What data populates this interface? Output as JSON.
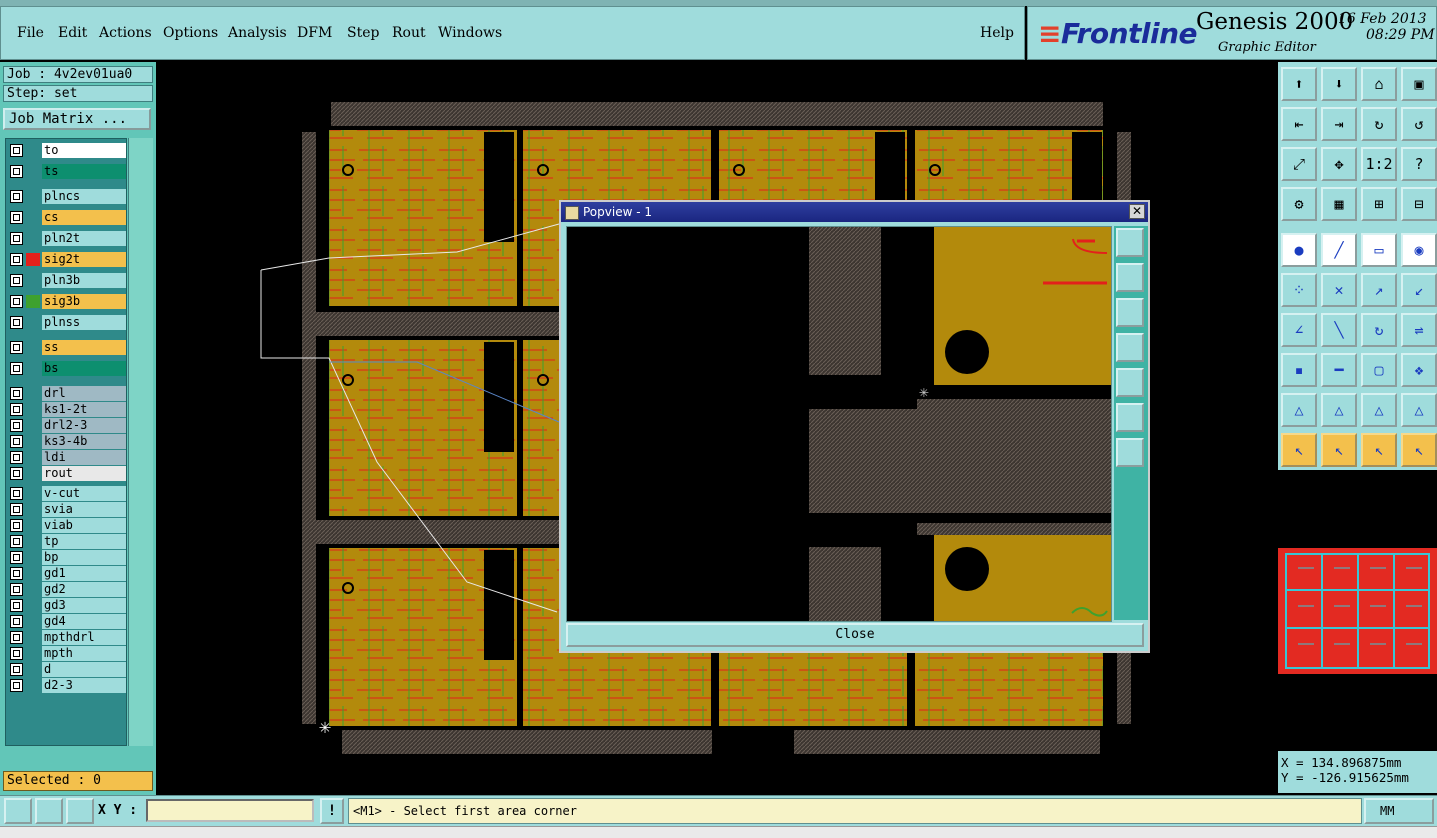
{
  "menubar": {
    "items": [
      "File",
      "Edit",
      "Actions",
      "Options",
      "Analysis",
      "DFM",
      "Step",
      "Rout",
      "Windows"
    ],
    "help": "Help"
  },
  "brand": {
    "logo": "Frontline",
    "product": "Genesis 2000",
    "subtitle": "Graphic Editor",
    "date": "16 Feb 2013",
    "time": "08:29 PM"
  },
  "job": {
    "job_label": "Job : 4v2ev01ua0",
    "step_label": "Step: set",
    "matrix_button": "Job Matrix ..."
  },
  "layers": [
    {
      "name": "to",
      "color": "#ffffff",
      "chip": ""
    },
    {
      "name": "ts",
      "color": "#0d8f6f",
      "chip": ""
    },
    {
      "name": "plncs",
      "color": "#9fdcdc",
      "chip": ""
    },
    {
      "name": "cs",
      "color": "#f3c04c",
      "chip": ""
    },
    {
      "name": "pln2t",
      "color": "#9fdcdc",
      "chip": ""
    },
    {
      "name": "sig2t",
      "color": "#f3c04c",
      "chip": "#e3201b"
    },
    {
      "name": "pln3b",
      "color": "#9fdcdc",
      "chip": ""
    },
    {
      "name": "sig3b",
      "color": "#f3c04c",
      "chip": "#3ea12e"
    },
    {
      "name": "plnss",
      "color": "#9fdcdc",
      "chip": ""
    },
    {
      "name": "ss",
      "color": "#f3c04c",
      "chip": ""
    },
    {
      "name": "bs",
      "color": "#0d8f6f",
      "chip": ""
    },
    {
      "name": "drl",
      "color": "#9fb9c4",
      "chip": ""
    },
    {
      "name": "ks1-2t",
      "color": "#9fb9c4",
      "chip": ""
    },
    {
      "name": "drl2-3",
      "color": "#9fb9c4",
      "chip": ""
    },
    {
      "name": "ks3-4b",
      "color": "#9fb9c4",
      "chip": ""
    },
    {
      "name": "ldi",
      "color": "#9fb9c4",
      "chip": ""
    },
    {
      "name": "rout",
      "color": "#e8e8e8",
      "chip": ""
    },
    {
      "name": "v-cut",
      "color": "#9fdcdc",
      "chip": ""
    },
    {
      "name": "svia",
      "color": "#9fdcdc",
      "chip": ""
    },
    {
      "name": "viab",
      "color": "#9fdcdc",
      "chip": ""
    },
    {
      "name": "tp",
      "color": "#9fdcdc",
      "chip": ""
    },
    {
      "name": "bp",
      "color": "#9fdcdc",
      "chip": ""
    },
    {
      "name": "gd1",
      "color": "#9fdcdc",
      "chip": ""
    },
    {
      "name": "gd2",
      "color": "#9fdcdc",
      "chip": ""
    },
    {
      "name": "gd3",
      "color": "#9fdcdc",
      "chip": ""
    },
    {
      "name": "gd4",
      "color": "#9fdcdc",
      "chip": ""
    },
    {
      "name": "mpthdrl",
      "color": "#9fdcdc",
      "chip": ""
    },
    {
      "name": "mpth",
      "color": "#9fdcdc",
      "chip": ""
    },
    {
      "name": "d",
      "color": "#9fdcdc",
      "chip": ""
    },
    {
      "name": "d2-3",
      "color": "#9fdcdc",
      "chip": ""
    }
  ],
  "selected_label": "Selected : 0",
  "popview": {
    "title": "Popview - 1",
    "close_label": "Close"
  },
  "coords": {
    "x_text": "X = 134.896875mm",
    "y_text": "Y = -126.915625mm"
  },
  "bottom": {
    "xy_label": "X Y :",
    "xy_value": "",
    "info_symbol": "!",
    "prompt": "<M1> - Select first area corner",
    "units": "MM"
  }
}
